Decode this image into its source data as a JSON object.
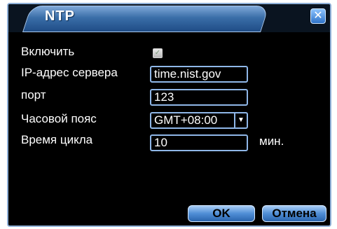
{
  "dialog": {
    "title": "NTP",
    "close_icon": "close-icon"
  },
  "form": {
    "enable_label": "Включить",
    "enable_checked": true,
    "server_label": "IP-адрес сервера",
    "server_value": "time.nist.gov",
    "port_label": "порт",
    "port_value": "123",
    "timezone_label": "Часовой пояс",
    "timezone_value": "GMT+08:00",
    "cycle_label": "Время цикла",
    "cycle_value": "10",
    "cycle_unit": "мин."
  },
  "buttons": {
    "ok_label": "OK",
    "cancel_label": "Отмена"
  },
  "colors": {
    "accent": "#3a6ea8",
    "field_border": "#8fb7e8",
    "background": "#000000"
  }
}
